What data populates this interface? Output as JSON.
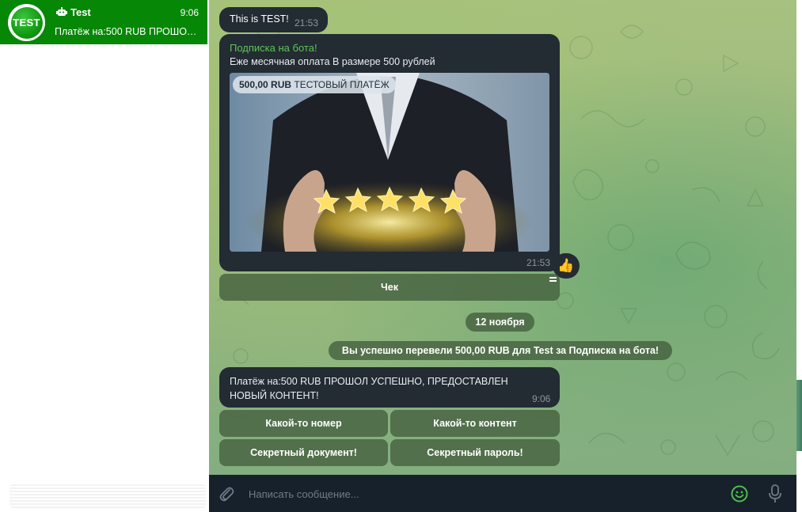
{
  "sidebar": {
    "chat": {
      "avatar_text": "TEST",
      "name": "Test",
      "time": "9:06",
      "preview": "Платёж на:500 RUB ПРОШОЛ УСПЕШНО, ПРЕДОСТАВЛЕН НОВЫЙ КОНТЕНТ!",
      "icon": "bot-icon"
    }
  },
  "messages": {
    "m1": {
      "text": "This is TEST!",
      "time": "21:53"
    },
    "m2": {
      "title": "Подписка на бота!",
      "description": "Еже месячная оплата В размере 500 рублей",
      "price": "500,00 RUB",
      "invoice_label": "ТЕСТОВЫЙ ПЛАТЁЖ",
      "time": "21:53",
      "reaction": "👍",
      "button": "Чек"
    },
    "date_separator": "12 ноября",
    "service": "Вы успешно перевели 500,00 RUB для Test за Подписка на бота!",
    "m3": {
      "text": "Платёж на:500 RUB ПРОШОЛ УСПЕШНО, ПРЕДОСТАВЛЕН НОВЫЙ КОНТЕНТ!",
      "time": "9:06"
    },
    "keyboard": [
      "Какой-то номер",
      "Какой-то контент",
      "Секретный документ!",
      "Секретный пароль!"
    ]
  },
  "composer": {
    "placeholder": "Написать сообщение...",
    "value": ""
  },
  "colors": {
    "sidebar_active": "#068706",
    "bubble": "#232b33",
    "accent_green": "#5ec456",
    "composer": "#17212b"
  }
}
